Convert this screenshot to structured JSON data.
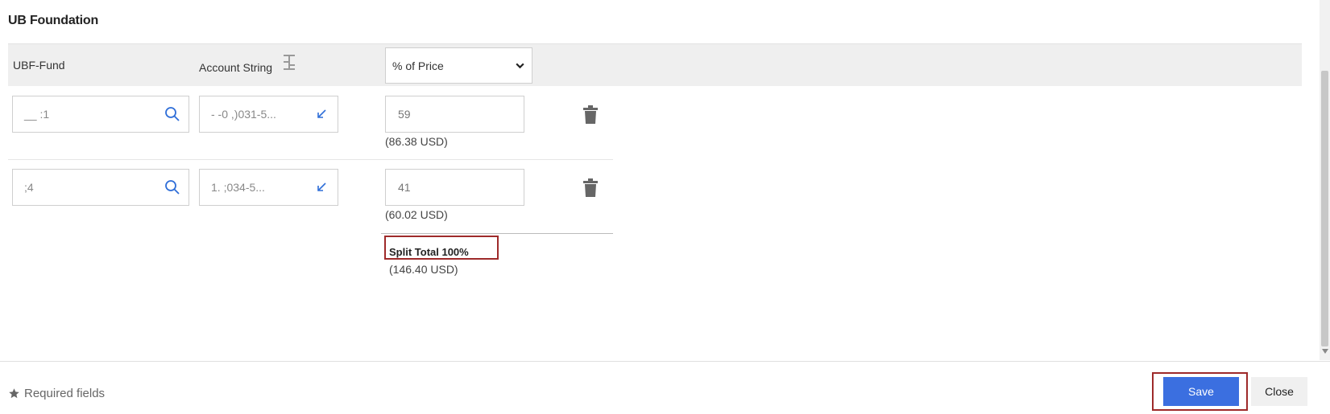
{
  "page_title": "UB Foundation",
  "columns": {
    "fund": "UBF-Fund",
    "account": "Account String",
    "split_mode": "% of Price"
  },
  "rows": [
    {
      "fund": "__ :1",
      "account": "- -0 ,)031-5...",
      "percent": "59",
      "usd": "(86.38 USD)"
    },
    {
      "fund": ";4",
      "account": "1.     ;034-5...",
      "percent": "41",
      "usd": "(60.02 USD)"
    }
  ],
  "total": {
    "label": "Split Total 100%",
    "usd": "(146.40 USD)"
  },
  "footer": {
    "required": "Required fields",
    "save": "Save",
    "close": "Close"
  },
  "colors": {
    "accent": "#3b6fe0",
    "highlight_border": "#9e2a2a",
    "header_bg": "#efefef"
  },
  "icons": [
    "search-icon",
    "arrow-down-left-icon",
    "trash-icon",
    "split-columns-icon",
    "chevron-down-icon",
    "star-icon"
  ]
}
